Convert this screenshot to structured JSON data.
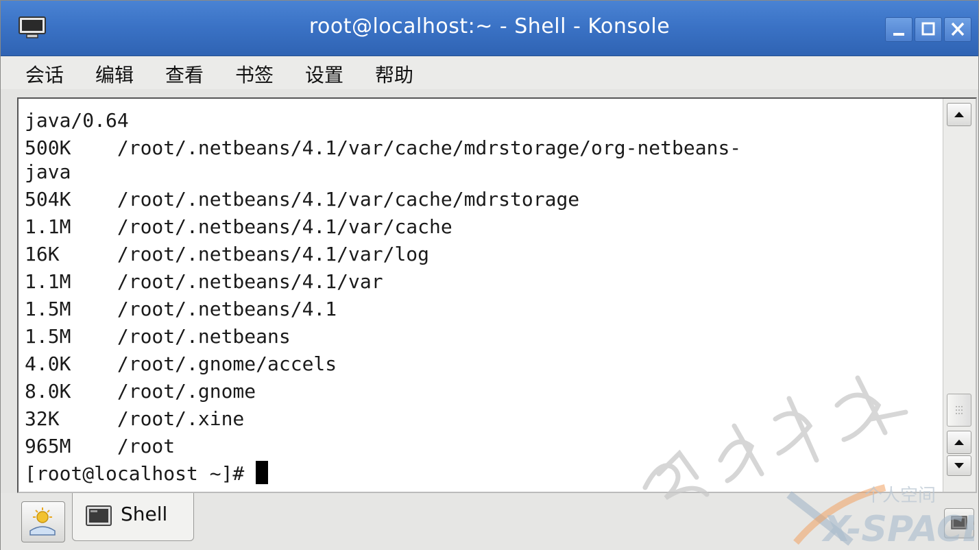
{
  "window": {
    "title": "root@localhost:~ - Shell - Konsole"
  },
  "menu": {
    "items": [
      "会话",
      "编辑",
      "查看",
      "书签",
      "设置",
      "帮助"
    ]
  },
  "terminal": {
    "lines": [
      "java/0.64",
      "500K    /root/.netbeans/4.1/var/cache/mdrstorage/org-netbeans-",
      "java",
      "504K    /root/.netbeans/4.1/var/cache/mdrstorage",
      "1.1M    /root/.netbeans/4.1/var/cache",
      "16K     /root/.netbeans/4.1/var/log",
      "1.1M    /root/.netbeans/4.1/var",
      "1.5M    /root/.netbeans/4.1",
      "1.5M    /root/.netbeans",
      "4.0K    /root/.gnome/accels",
      "8.0K    /root/.gnome",
      "32K     /root/.xine",
      "965M    /root"
    ],
    "prompt": "[root@localhost ~]# "
  },
  "tabs": [
    {
      "label": "Shell",
      "icon": "terminal-icon"
    }
  ],
  "watermark": {
    "logo_text": "个人空间",
    "logo_brand": "X-SPACE"
  },
  "icons": {
    "app": "konsole-monitor-icon",
    "new_session": "new-session-icon",
    "minimize": "minimize-icon",
    "maximize": "maximize-icon",
    "close": "close-icon"
  },
  "colors": {
    "titlebar": "#3b73c6",
    "terminal_bg": "#ffffff",
    "terminal_fg": "#1a1a1a"
  }
}
